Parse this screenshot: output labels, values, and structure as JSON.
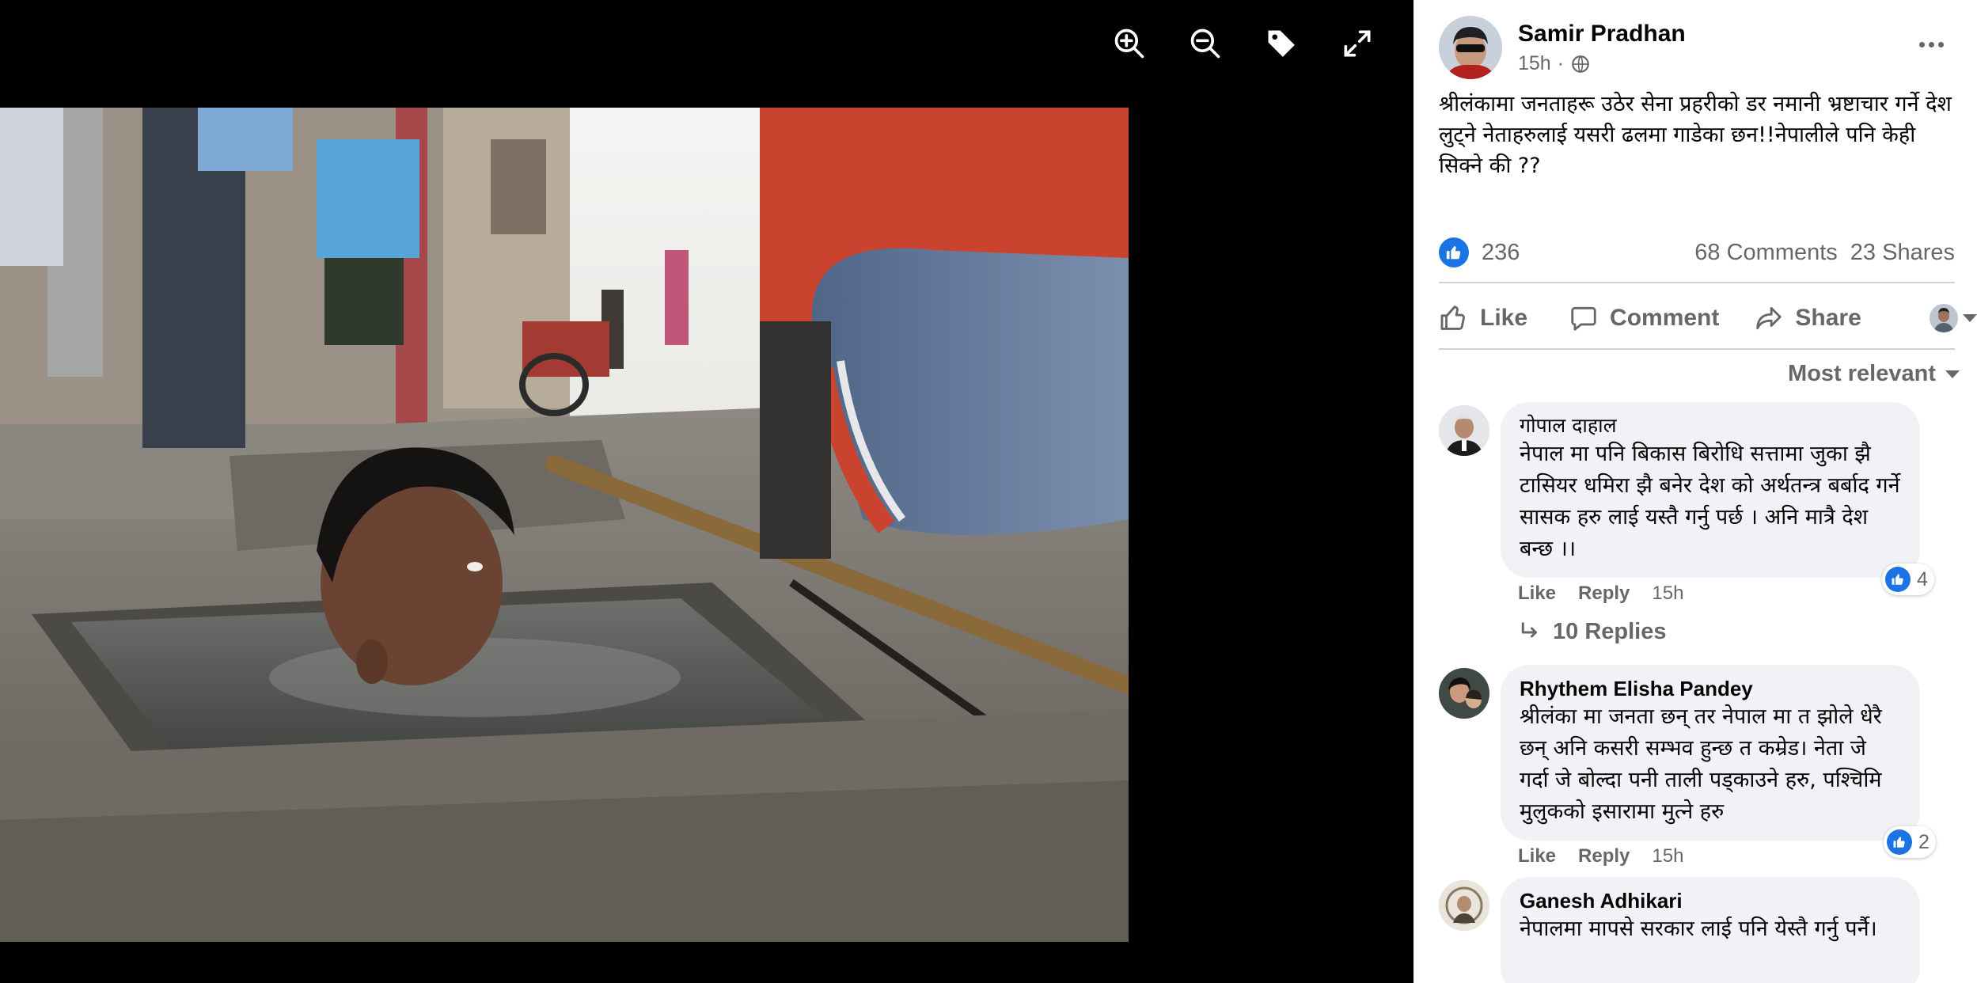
{
  "viewer": {
    "toolbar": [
      {
        "name": "zoom-in-button",
        "icon": "zoom-in-icon"
      },
      {
        "name": "zoom-out-button",
        "icon": "zoom-out-icon"
      },
      {
        "name": "tag-button",
        "icon": "tag-icon"
      },
      {
        "name": "fullscreen-button",
        "icon": "fullscreen-icon"
      }
    ]
  },
  "post": {
    "author": "Samir Pradhan",
    "time": "15h",
    "privacy_icon": "globe-icon",
    "text": "श्रीलंकामा जनताहरू उठेर सेना प्रहरीको डर नमानी भ्रष्टाचार गर्ने देश लुट्ने नेताहरुलाई यसरी ढलमा गाडेका छन!!नेपालीले पनि केही सिक्ने की ??",
    "likes": "236",
    "comments": "68 Comments",
    "shares": "23 Shares"
  },
  "actions": {
    "like": "Like",
    "comment": "Comment",
    "share": "Share"
  },
  "sort_label": "Most relevant",
  "comments": [
    {
      "name": "गोपाल दाहाल",
      "text": "नेपाल मा पनि बिकास बिरोधि सत्तामा जुका झै टासियर धमिरा झै बनेर देश को अर्थतन्त्र बर्बाद गर्ने सासक हरु लाई यस्तै गर्नु पर्छ । अनि मात्रै देश बन्छ ।।",
      "reactions": "4",
      "like": "Like",
      "reply": "Reply",
      "time": "15h",
      "replies": "10 Replies"
    },
    {
      "name": "Rhythem Elisha Pandey",
      "text": "श्रीलंका मा जनता छन् तर नेपाल मा त झोले धेरै छन् अनि कसरी सम्भव हुन्छ त कम्रेड। नेता जे गर्दा जे बोल्दा पनी ताली पड्काउने हरु, पश्चिमि मुलुकको इसारामा मुत्ने हरु",
      "reactions": "2",
      "like": "Like",
      "reply": "Reply",
      "time": "15h"
    },
    {
      "name": "Ganesh Adhikari",
      "text": "नेपालमा मापसे सरकार लाई पनि येस्तै गर्नु पर्नै।"
    }
  ],
  "colors": {
    "accent": "#1b74e4",
    "secondary_text": "#65676b",
    "bubble": "#f0f2f5"
  }
}
